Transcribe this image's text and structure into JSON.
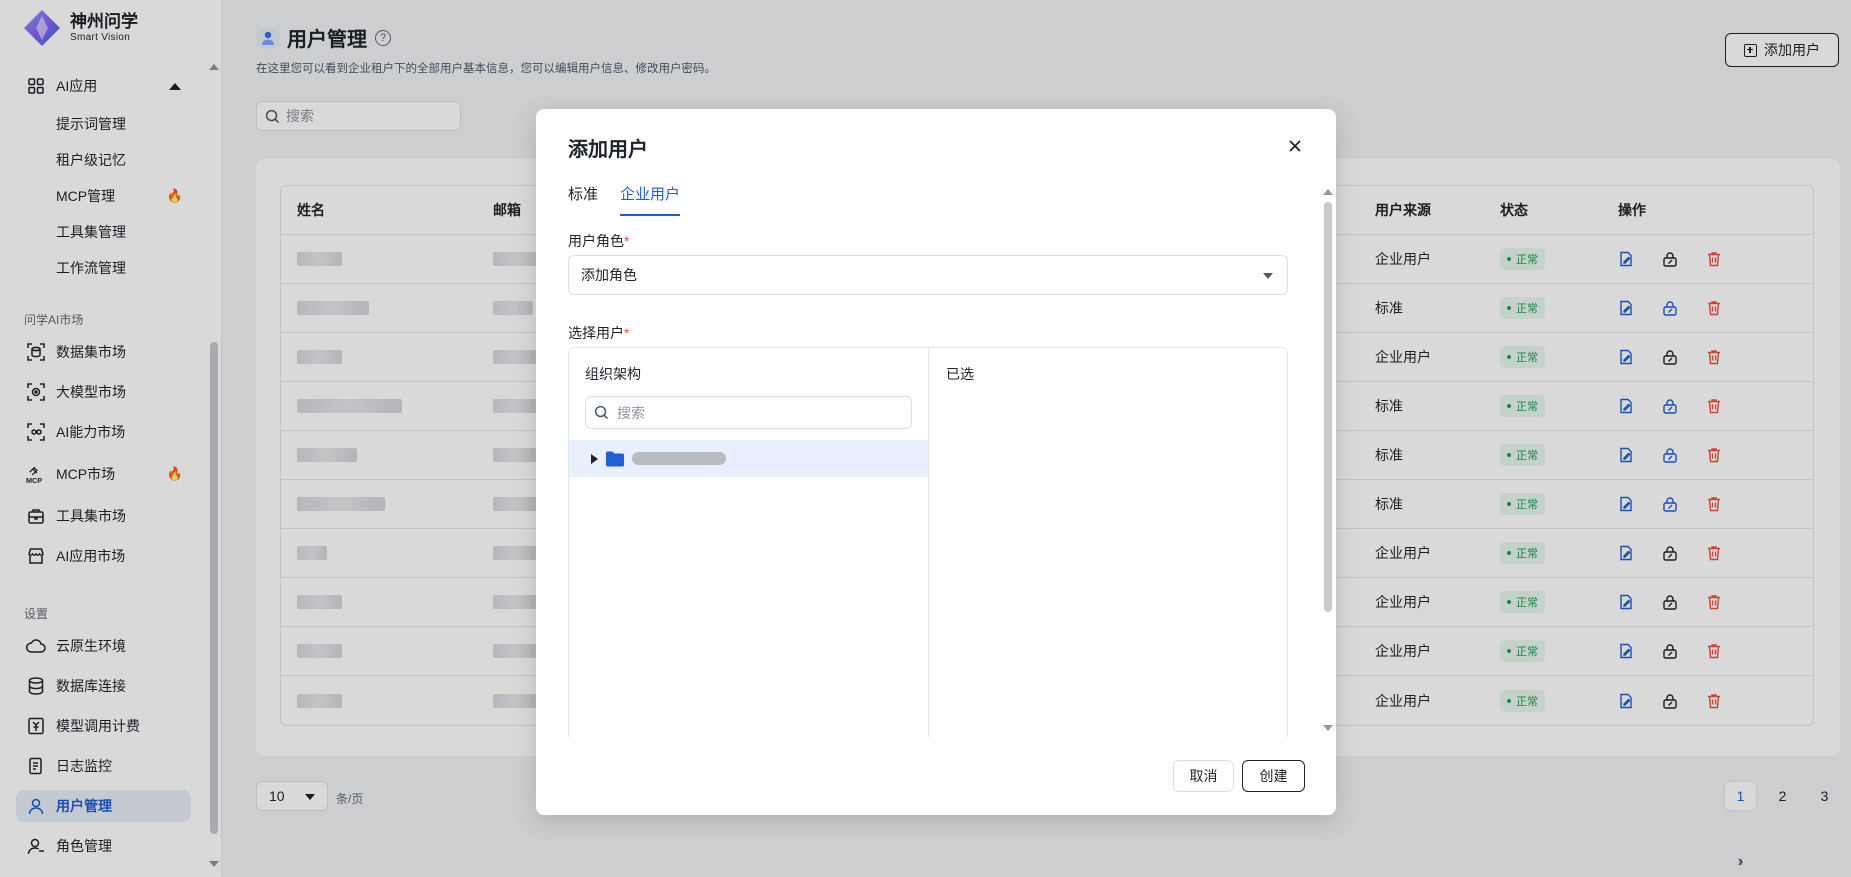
{
  "brand": {
    "name_cn": "神州问学",
    "name_en": "Smart Vision"
  },
  "sidebar": {
    "ai_apps": {
      "label": "AI应用"
    },
    "ai_sub": [
      {
        "label": "提示词管理",
        "hot": false
      },
      {
        "label": "租户级记忆",
        "hot": false
      },
      {
        "label": "MCP管理",
        "hot": true
      },
      {
        "label": "工具集管理",
        "hot": false
      },
      {
        "label": "工作流管理",
        "hot": false
      }
    ],
    "market_group": "问学AI市场",
    "market_items": [
      {
        "label": "数据集市场",
        "icon": "dataset-icon",
        "hot": false
      },
      {
        "label": "大模型市场",
        "icon": "model-icon",
        "hot": false
      },
      {
        "label": "AI能力市场",
        "icon": "ability-icon",
        "hot": false
      },
      {
        "label": "MCP市场",
        "icon": "mcp-icon",
        "hot": true
      },
      {
        "label": "工具集市场",
        "icon": "toolbox-icon",
        "hot": false
      },
      {
        "label": "AI应用市场",
        "icon": "store-icon",
        "hot": false
      }
    ],
    "settings_group": "设置",
    "settings_items": [
      {
        "label": "云原生环境",
        "icon": "cloud-icon"
      },
      {
        "label": "数据库连接",
        "icon": "database-icon"
      },
      {
        "label": "模型调用计费",
        "icon": "billing-icon"
      },
      {
        "label": "日志监控",
        "icon": "log-icon"
      },
      {
        "label": "用户管理",
        "icon": "user-icon",
        "active": true
      },
      {
        "label": "角色管理",
        "icon": "role-icon"
      }
    ],
    "mcp_icon_text": "MCP"
  },
  "page": {
    "title": "用户管理",
    "help": "?",
    "description": "在这里您可以看到企业租户下的全部用户基本信息，您可以编辑用户信息、修改用户密码。",
    "add_user_label": "添加用户",
    "search_placeholder": "搜索"
  },
  "table": {
    "headers": {
      "name": "姓名",
      "email": "邮箱",
      "source": "用户来源",
      "status": "状态",
      "actions": "操作"
    },
    "rows": [
      {
        "source": "企业用户",
        "status": "正常",
        "enterprise": true
      },
      {
        "source": "标准",
        "status": "正常",
        "enterprise": false
      },
      {
        "source": "企业用户",
        "status": "正常",
        "enterprise": true
      },
      {
        "source": "标准",
        "status": "正常",
        "enterprise": false
      },
      {
        "source": "标准",
        "status": "正常",
        "enterprise": false
      },
      {
        "source": "标准",
        "status": "正常",
        "enterprise": false
      },
      {
        "source": "企业用户",
        "status": "正常",
        "enterprise": true
      },
      {
        "source": "企业用户",
        "status": "正常",
        "enterprise": true
      },
      {
        "source": "企业用户",
        "status": "正常",
        "enterprise": true
      },
      {
        "source": "企业用户",
        "status": "正常",
        "enterprise": true
      }
    ]
  },
  "pagination": {
    "page_size": "10",
    "per_page_label": "条/页",
    "pages": [
      "1",
      "2",
      "3"
    ],
    "current": "1",
    "prev": "‹",
    "next": "›"
  },
  "modal": {
    "title": "添加用户",
    "tabs": [
      {
        "label": "标准",
        "active": false
      },
      {
        "label": "企业用户",
        "active": true
      }
    ],
    "role_label": "用户角色",
    "role_placeholder": "添加角色",
    "users_label": "选择用户",
    "required_mark": "*",
    "org_title": "组织架构",
    "org_search_placeholder": "搜索",
    "selected_title": "已选",
    "cancel_label": "取消",
    "create_label": "创建"
  },
  "colors": {
    "accent": "#1f5fd6",
    "success": "#1e9e5a",
    "danger": "#f04e37"
  }
}
